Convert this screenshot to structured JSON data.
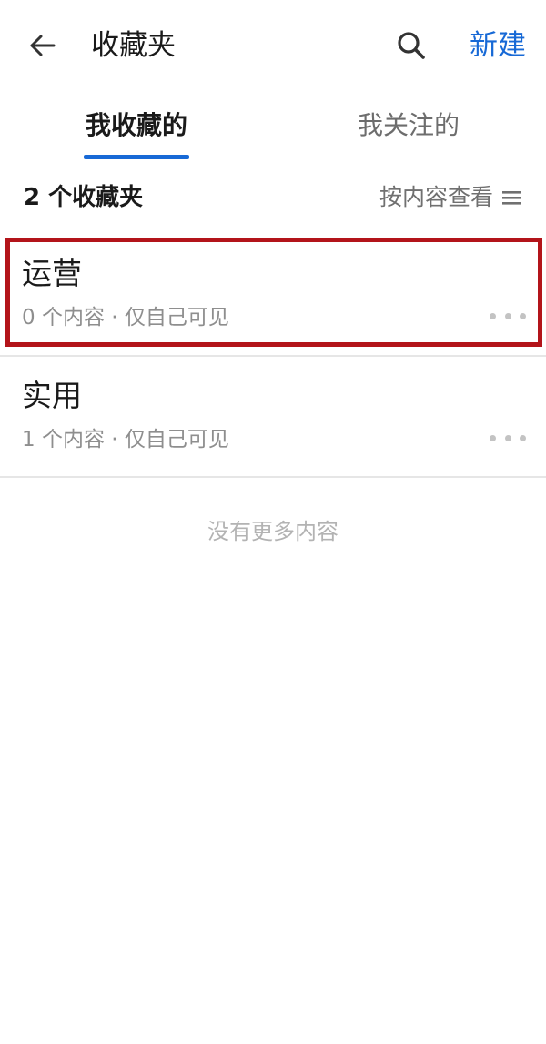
{
  "header": {
    "title": "收藏夹",
    "new_label": "新建",
    "back_icon": "arrow-left-icon",
    "search_icon": "search-icon"
  },
  "tabs": [
    {
      "label": "我收藏的",
      "active": true
    },
    {
      "label": "我关注的",
      "active": false
    }
  ],
  "summary": {
    "count_text": "2 个收藏夹",
    "sort_label": "按内容查看",
    "sort_icon": "list-icon"
  },
  "folders": [
    {
      "name": "运营",
      "meta": "0 个内容 · 仅自己可见",
      "highlighted": true
    },
    {
      "name": "实用",
      "meta": "1 个内容 · 仅自己可见",
      "highlighted": false
    }
  ],
  "footer": {
    "no_more_text": "没有更多内容"
  },
  "colors": {
    "accent": "#1769d6",
    "highlight": "#b3141a",
    "muted": "#8e8e8e"
  }
}
